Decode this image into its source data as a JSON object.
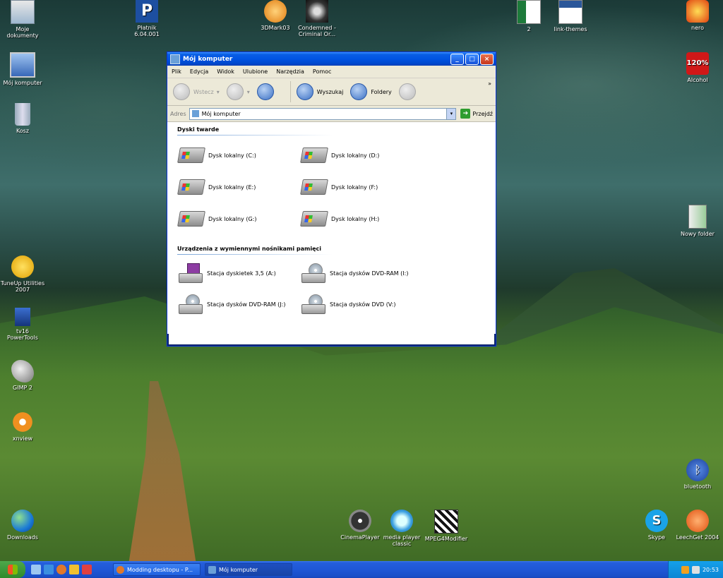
{
  "desktop": {
    "icons": [
      {
        "key": "moje_dokumenty",
        "label": "Moje dokumenty",
        "icon": "folder-documents-icon"
      },
      {
        "key": "platnik",
        "label": "Płatnik 6.04.001",
        "icon": "platnik-app-icon"
      },
      {
        "key": "3dmark",
        "label": "3DMark03",
        "icon": "3dmark-app-icon"
      },
      {
        "key": "condemned",
        "label": "Condemned - Criminal Or...",
        "icon": "condemned-game-icon"
      },
      {
        "key": "excel2",
        "label": "2",
        "icon": "excel-file-icon"
      },
      {
        "key": "link_themes",
        "label": "link-themes",
        "icon": "word-file-icon"
      },
      {
        "key": "nero",
        "label": "nero",
        "icon": "nero-app-icon"
      },
      {
        "key": "moj_komputer",
        "label": "Mój komputer",
        "icon": "my-computer-icon"
      },
      {
        "key": "alcohol",
        "label": "Alcohol",
        "icon": "alcohol-120-icon"
      },
      {
        "key": "kosz",
        "label": "Kosz",
        "icon": "recycle-bin-icon"
      },
      {
        "key": "nowy_folder",
        "label": "Nowy folder",
        "icon": "new-folder-icon"
      },
      {
        "key": "tuneup",
        "label": "TuneUp Utilities 2007",
        "icon": "tuneup-app-icon"
      },
      {
        "key": "tv16",
        "label": "tv16 PowerTools",
        "icon": "powertools-app-icon"
      },
      {
        "key": "gimp",
        "label": "GIMP 2",
        "icon": "gimp-app-icon"
      },
      {
        "key": "xnview",
        "label": "xnview",
        "icon": "xnview-app-icon"
      },
      {
        "key": "bluetooth",
        "label": "bluetooth",
        "icon": "bluetooth-icon"
      },
      {
        "key": "downloads",
        "label": "Downloads",
        "icon": "downloads-globe-icon"
      },
      {
        "key": "cinemaplayer",
        "label": "CinemaPlayer",
        "icon": "film-reel-icon"
      },
      {
        "key": "mpc",
        "label": "media player classic",
        "icon": "media-player-classic-icon"
      },
      {
        "key": "mpeg4",
        "label": "MPEG4Modifier",
        "icon": "clapperboard-icon"
      },
      {
        "key": "skype",
        "label": "Skype",
        "icon": "skype-icon"
      },
      {
        "key": "leechget",
        "label": "LeechGet 2004",
        "icon": "leechget-icon"
      }
    ]
  },
  "window": {
    "title": "Mój komputer",
    "menu": [
      "Plik",
      "Edycja",
      "Widok",
      "Ulubione",
      "Narzędzia",
      "Pomoc"
    ],
    "toolbar": {
      "back_label": "Wstecz",
      "search_label": "Wyszukaj",
      "folders_label": "Foldery",
      "more": "»"
    },
    "address": {
      "label": "Adres",
      "value": "Mój komputer",
      "go_label": "Przejdź"
    },
    "sections": {
      "hard_drives": "Dyski twarde",
      "removable": "Urządzenia z wymiennymi nośnikami pamięci"
    },
    "hard_drives": [
      "Dysk lokalny (C:)",
      "Dysk lokalny (D:)",
      "Dysk lokalny (E:)",
      "Dysk lokalny (F:)",
      "Dysk lokalny (G:)",
      "Dysk lokalny (H:)"
    ],
    "removable": [
      "Stacja dyskietek 3,5 (A:)",
      "Stacja dysków DVD-RAM (I:)",
      "Stacja dysków DVD-RAM (J:)",
      "Stacja dysków DVD (V:)"
    ]
  },
  "taskbar": {
    "tasks": [
      {
        "label": "Modding desktopu - P...",
        "icon": "firefox-icon"
      },
      {
        "label": "Mój komputer",
        "icon": "my-computer-icon"
      }
    ],
    "clock": "20:53"
  }
}
